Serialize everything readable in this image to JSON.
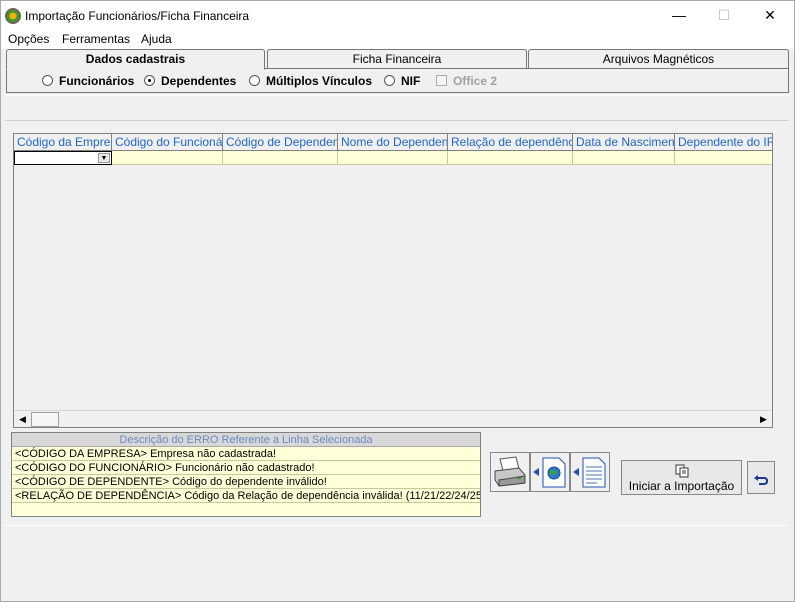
{
  "window": {
    "title": "Importação Funcionários/Ficha Financeira",
    "minimize": "—",
    "maximize": "☐",
    "close": "✕"
  },
  "menu": [
    "Opções",
    "Ferramentas",
    "Ajuda"
  ],
  "tabs": [
    "Dados cadastrais",
    "Ficha Financeira",
    "Arquivos Magnéticos"
  ],
  "options": {
    "funcionarios": "Funcionários",
    "dependentes": "Dependentes",
    "multiplos": "Múltiplos Vínculos",
    "nif": "NIF",
    "office2": "Office 2",
    "selected": "Dependentes"
  },
  "grid": {
    "columns": [
      "Código da Empresa",
      "Código do Funcionário",
      "Código de Dependente",
      "Nome do Dependente",
      "Relação de dependência",
      "Data de Nascimento",
      "Dependente do IRF"
    ]
  },
  "errors": {
    "header": "Descrição do ERRO Referente a Linha Selecionada",
    "lines": [
      "<CÓDIGO DA EMPRESA>  Empresa não cadastrada!",
      "<CÓDIGO DO FUNCIONÁRIO>  Funcionário não cadastrado!",
      "<CÓDIGO DE DEPENDENTE>  Código do dependente inválido!",
      "<RELAÇÃO DE DEPENDÊNCIA>  Código da Relação de dependência inválida! (11/21/22/24/25"
    ]
  },
  "buttons": {
    "start_import": "Iniciar a Importação"
  },
  "icons": {
    "printer": "printer-icon",
    "export_web": "export-web-icon",
    "export_doc": "export-doc-icon",
    "copy": "copy-icon",
    "undo": "undo-icon"
  }
}
